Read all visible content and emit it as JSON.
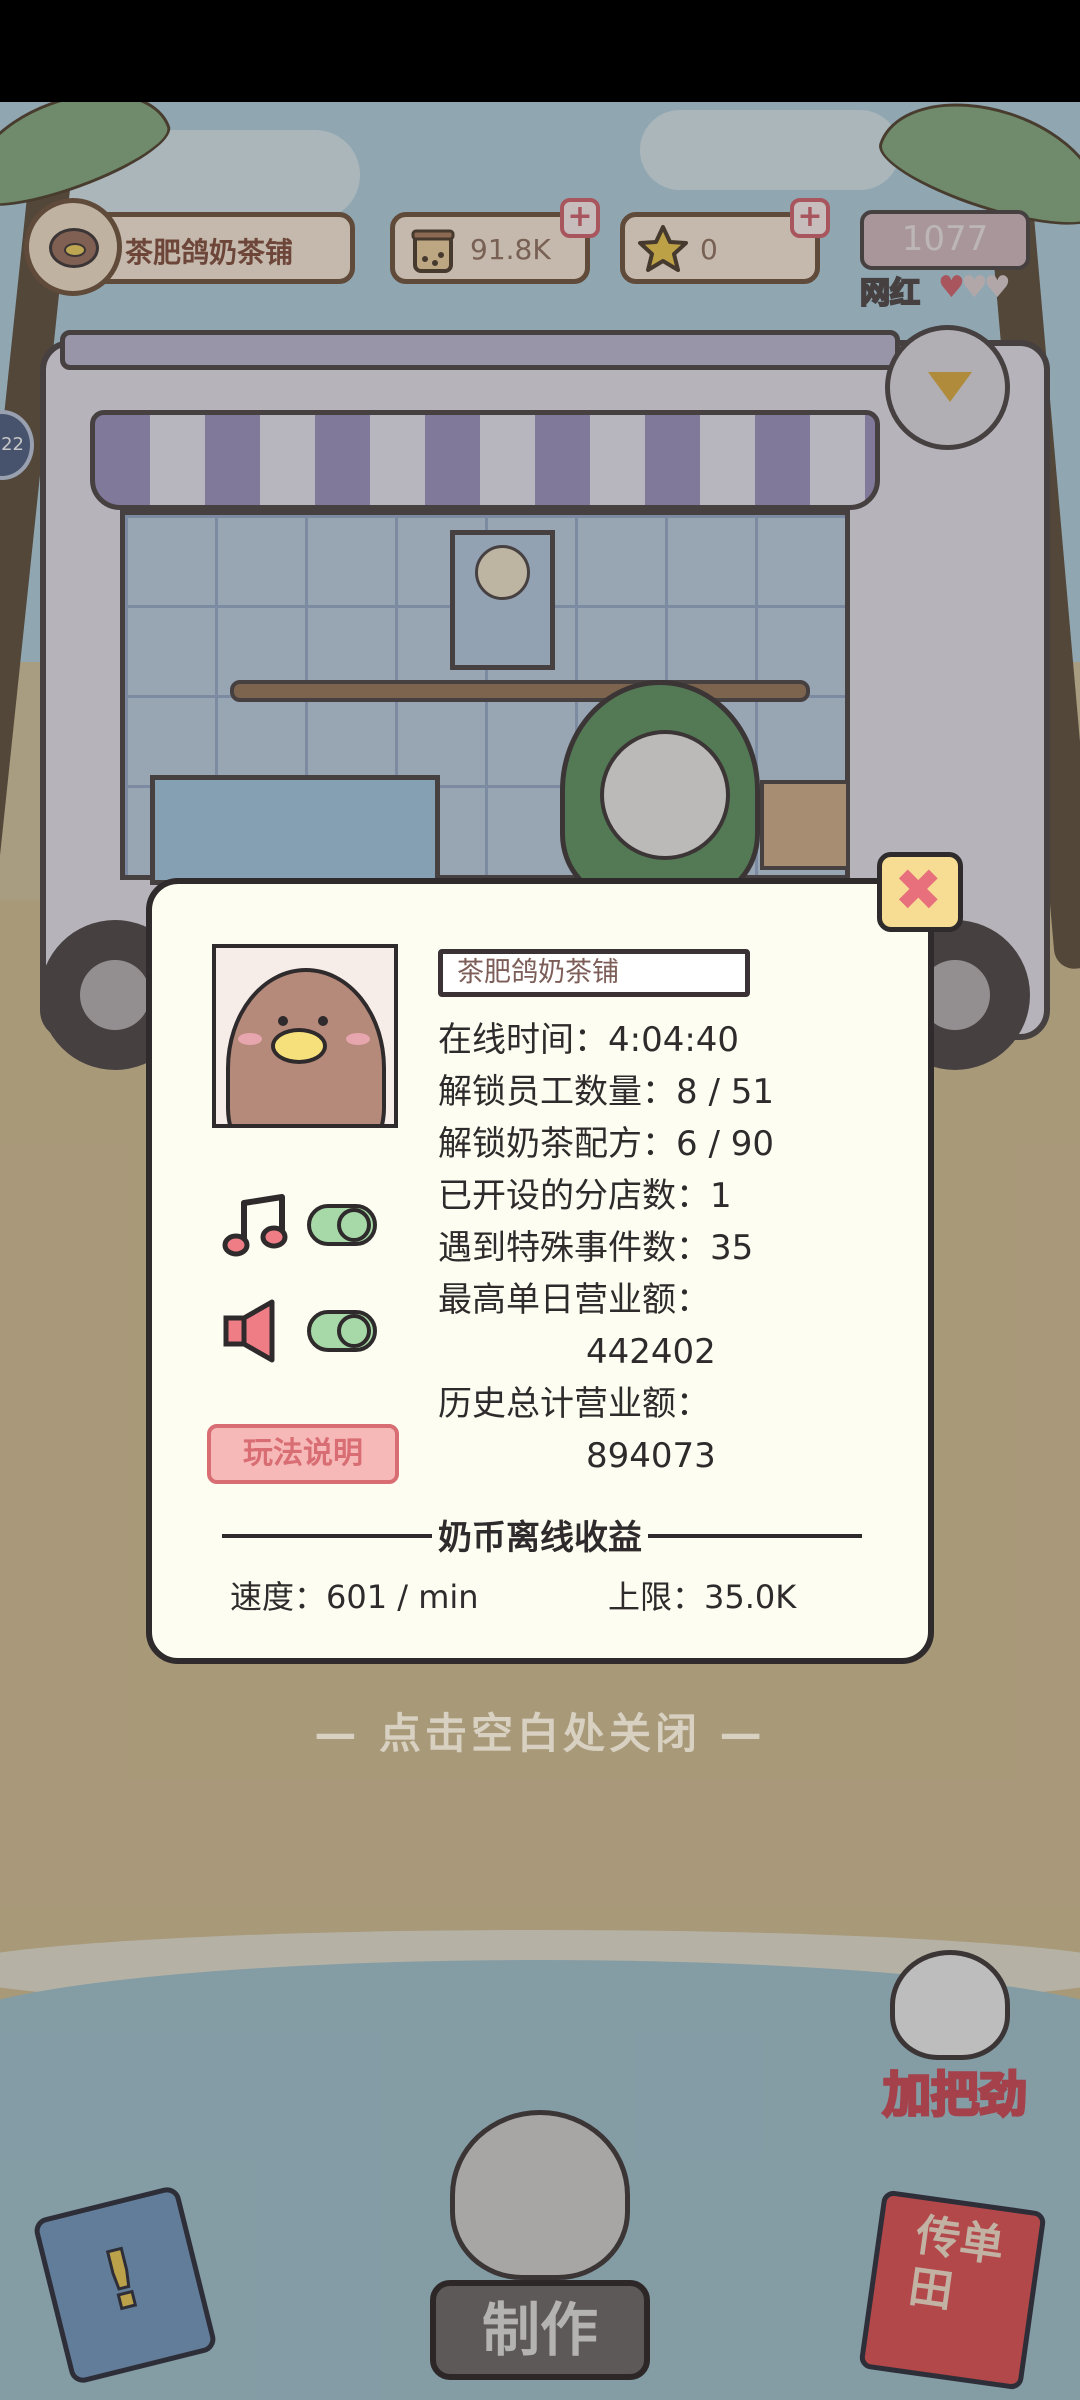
{
  "hud": {
    "shop_name": "茶肥鸽奶茶铺",
    "milk_tea_coins": "91.8K",
    "stars": "0",
    "fame_value": "1077",
    "fame_label": "网红",
    "fame_hearts_filled": 1,
    "fame_hearts_total": 3,
    "plus_symbol": "+",
    "side_tab_text": "22",
    "fame_heart_glyph": "♥"
  },
  "hint": "— 点击空白处关闭 —",
  "dialog": {
    "close_symbol": "✖",
    "shop_name": "茶肥鸽奶茶铺",
    "stats": {
      "online_time": "在线时间：4:04:40",
      "staff_unlocked": "解锁员工数量：8 / 51",
      "recipes_unlocked": "解锁奶茶配方：6 / 90",
      "branches_opened": "已开设的分店数：1",
      "special_events": "遇到特殊事件数：35",
      "best_day_label": "最高单日营业额：",
      "best_day_value": "442402",
      "total_revenue_label": "历史总计营业额：",
      "total_revenue_value": "894073"
    },
    "music_on": true,
    "sound_on": true,
    "guide_button": "玩法说明",
    "offline_title": "奶币离线收益",
    "speed": "速度：601 / min",
    "limit": "上限：35.0K"
  },
  "bottom": {
    "cheer_button": "加把劲",
    "make_button": "制作",
    "flyer_button": "传单田"
  },
  "colors": {
    "dialog_bg": "#fdfdf1",
    "accent_pink": "#d96d78",
    "toggle_on": "#a6d9a7"
  }
}
